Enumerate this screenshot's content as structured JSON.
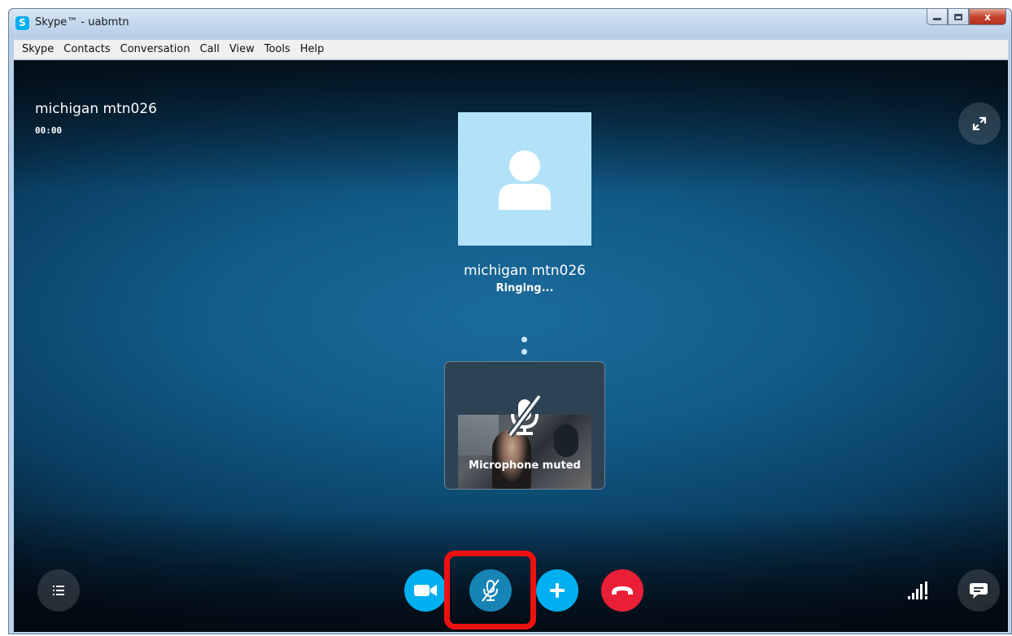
{
  "window": {
    "title": "Skype™ - uabmtn",
    "app_icon_letter": "S",
    "close_glyph": "x"
  },
  "menu": {
    "items": [
      "Skype",
      "Contacts",
      "Conversation",
      "Call",
      "View",
      "Tools",
      "Help"
    ]
  },
  "call": {
    "caller_top_name": "michigan mtn026",
    "duration": "00:00",
    "contact_name": "michigan mtn026",
    "status": "Ringing...",
    "self_view_status": "Microphone muted"
  },
  "colors": {
    "skype_blue": "#00aff0",
    "end_call_red": "#e81f36",
    "highlight_red": "#ee1111",
    "avatar_tile": "#b2e2f7"
  },
  "icons": {
    "expand": "expand-arrows-icon",
    "avatar": "person-silhouette-icon",
    "mic_muted": "microphone-off-icon",
    "menu": "list-icon",
    "video": "video-camera-icon",
    "add": "plus-icon",
    "end_call": "phone-hangup-icon",
    "signal": "signal-strength-icon",
    "chat": "chat-bubble-icon"
  }
}
